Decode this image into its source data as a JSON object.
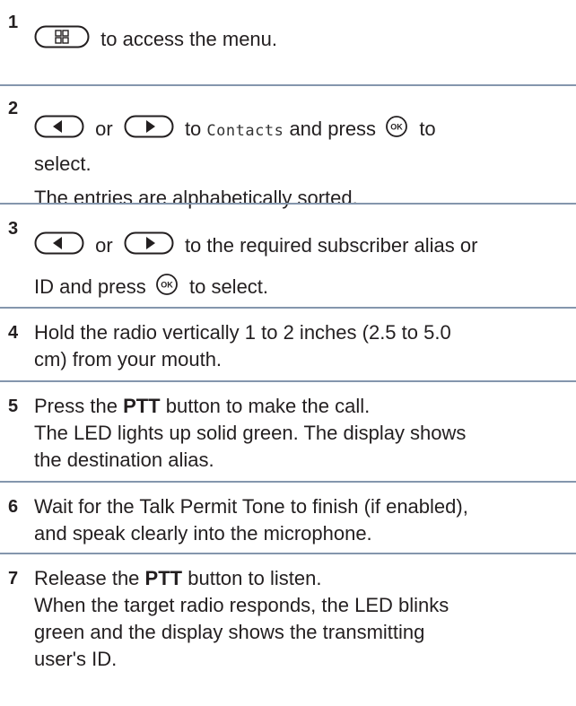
{
  "step1": {
    "number": "1",
    "text": "to access the menu.",
    "button_icon": "menu-button-icon"
  },
  "step2": {
    "number": "2",
    "or": "or",
    "to": "to",
    "menu_item": "Contacts",
    "press": "and press",
    "to2": "to",
    "select": "select.",
    "note": "The entries are alphabetically sorted.",
    "icons": [
      "left-arrow-button-icon",
      "right-arrow-button-icon",
      "ok-button-icon"
    ]
  },
  "step3": {
    "number": "3",
    "or": "or",
    "line1_end": "to the required subscriber alias or",
    "line2_start": "ID and press",
    "line2_end": "to select.",
    "icons": [
      "left-arrow-button-icon",
      "right-arrow-button-icon",
      "ok-button-icon"
    ]
  },
  "step4": {
    "number": "4",
    "line1": "Hold the radio vertically 1 to 2 inches (2.5 to 5.0",
    "line2": "cm) from your mouth."
  },
  "step5": {
    "number": "5",
    "pre": "Press the",
    "bold": "PTT",
    "post": "button to make the call.",
    "line2": "The LED lights up solid green. The display shows",
    "line3": "the destination alias."
  },
  "step6": {
    "number": "6",
    "line1": "Wait for the Talk Permit Tone to finish (if enabled),",
    "line2": "and speak clearly into the microphone."
  },
  "step7": {
    "number": "7",
    "pre": "Release the",
    "bold": "PTT",
    "post": "button to listen.",
    "line2": "When the target radio responds, the LED blinks",
    "line3": "green and the display shows the transmitting",
    "line4": "user's ID."
  },
  "ok_label": "OK",
  "divider_color": "#8496ad"
}
